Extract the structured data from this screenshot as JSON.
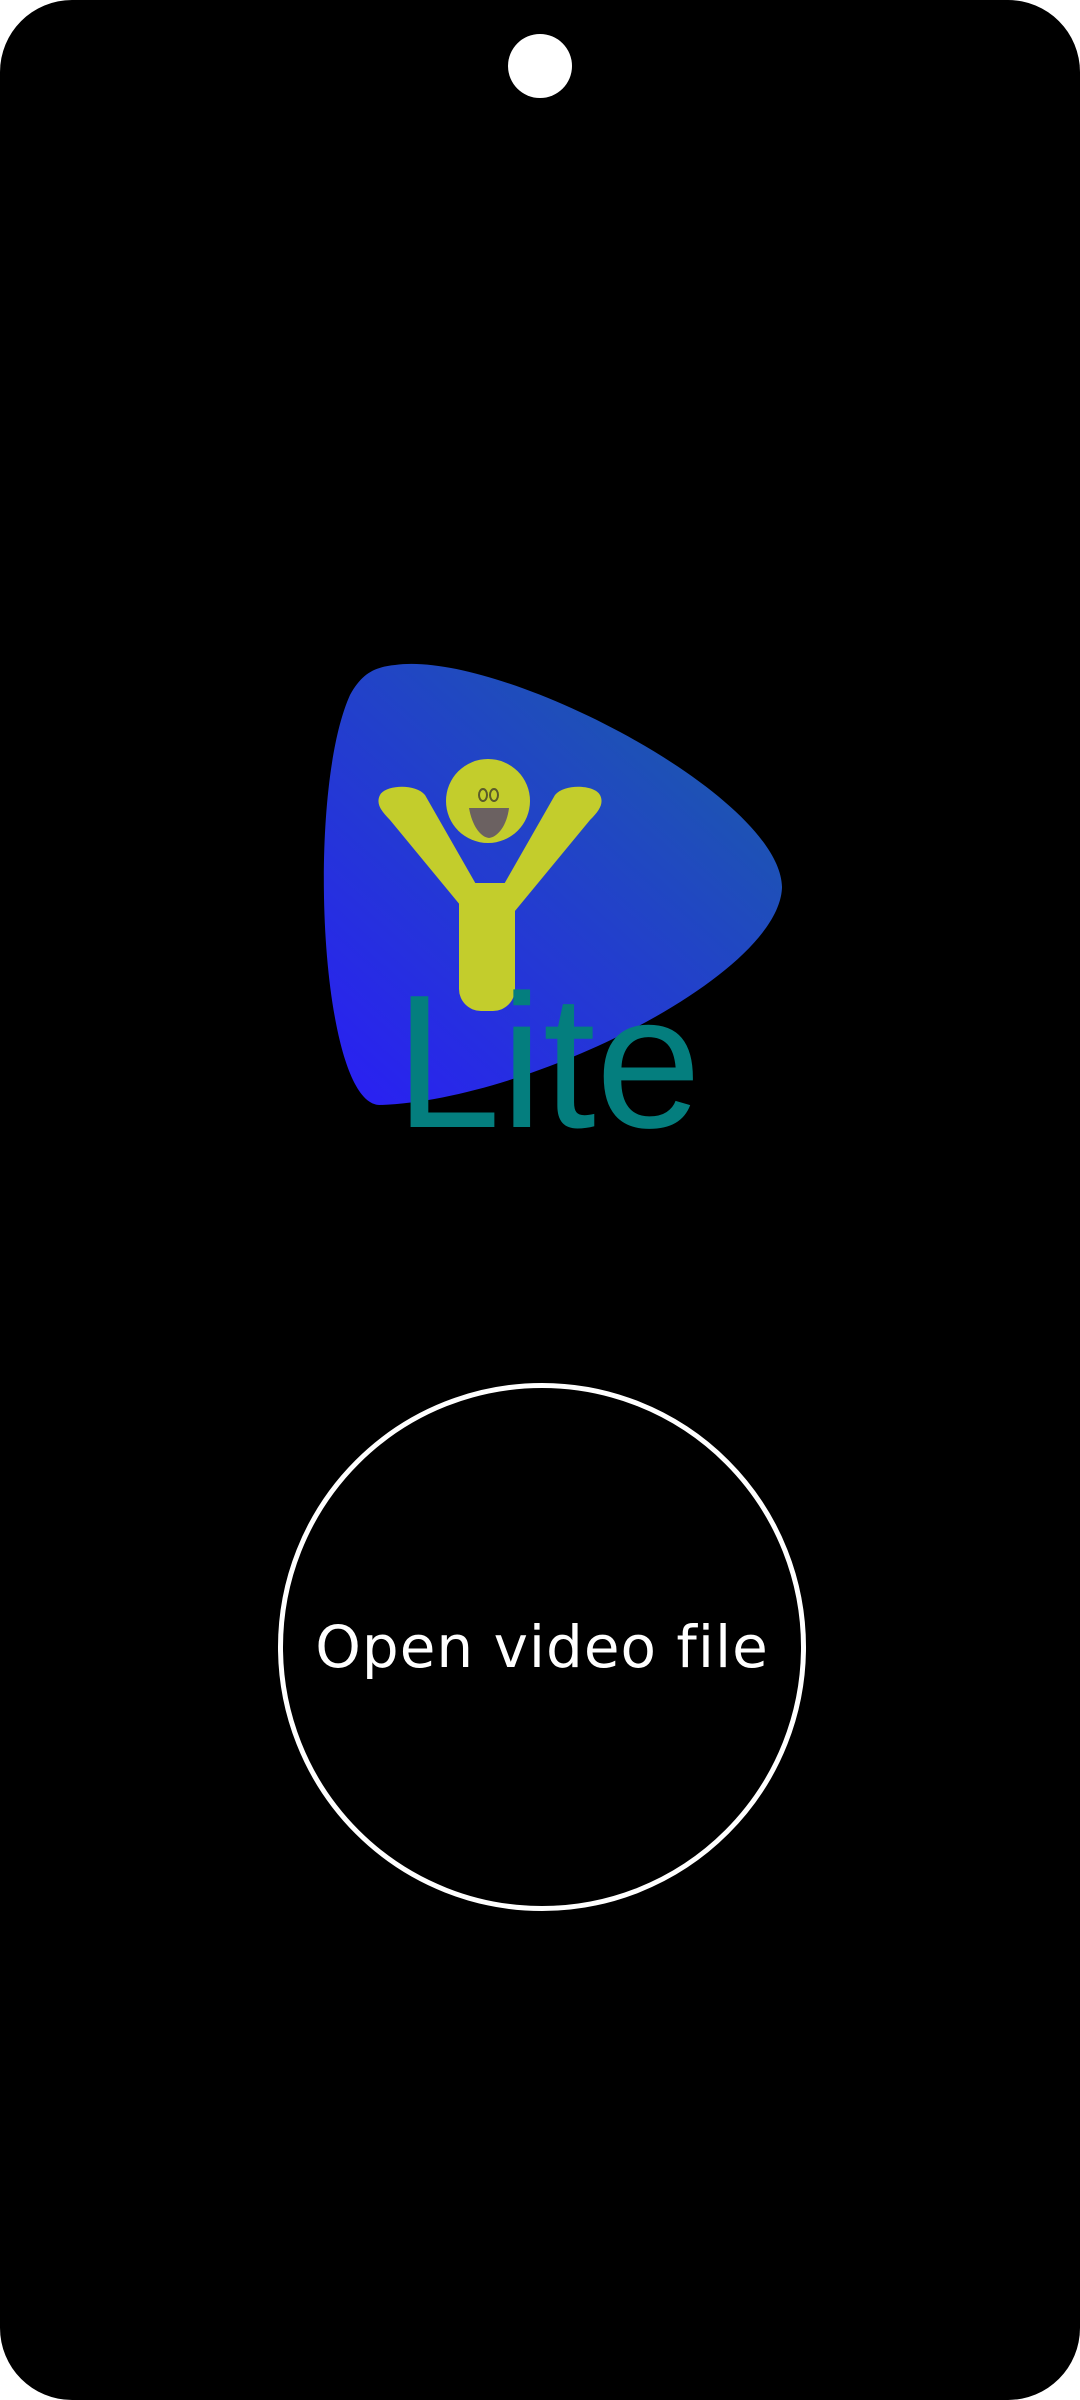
{
  "logo": {
    "icon": "smiling-y-figure-on-play-triangle",
    "word": "Lite",
    "colors": {
      "triangle_top": "#1b5ea6",
      "triangle_bottom": "#2a1ef5",
      "figure": "#c3cd2c",
      "mouth": "#6b6161",
      "word": "#047e7e"
    }
  },
  "open_button": {
    "label": "Open video file",
    "border_color": "#ffffff"
  },
  "screen": {
    "background": "#000000"
  }
}
